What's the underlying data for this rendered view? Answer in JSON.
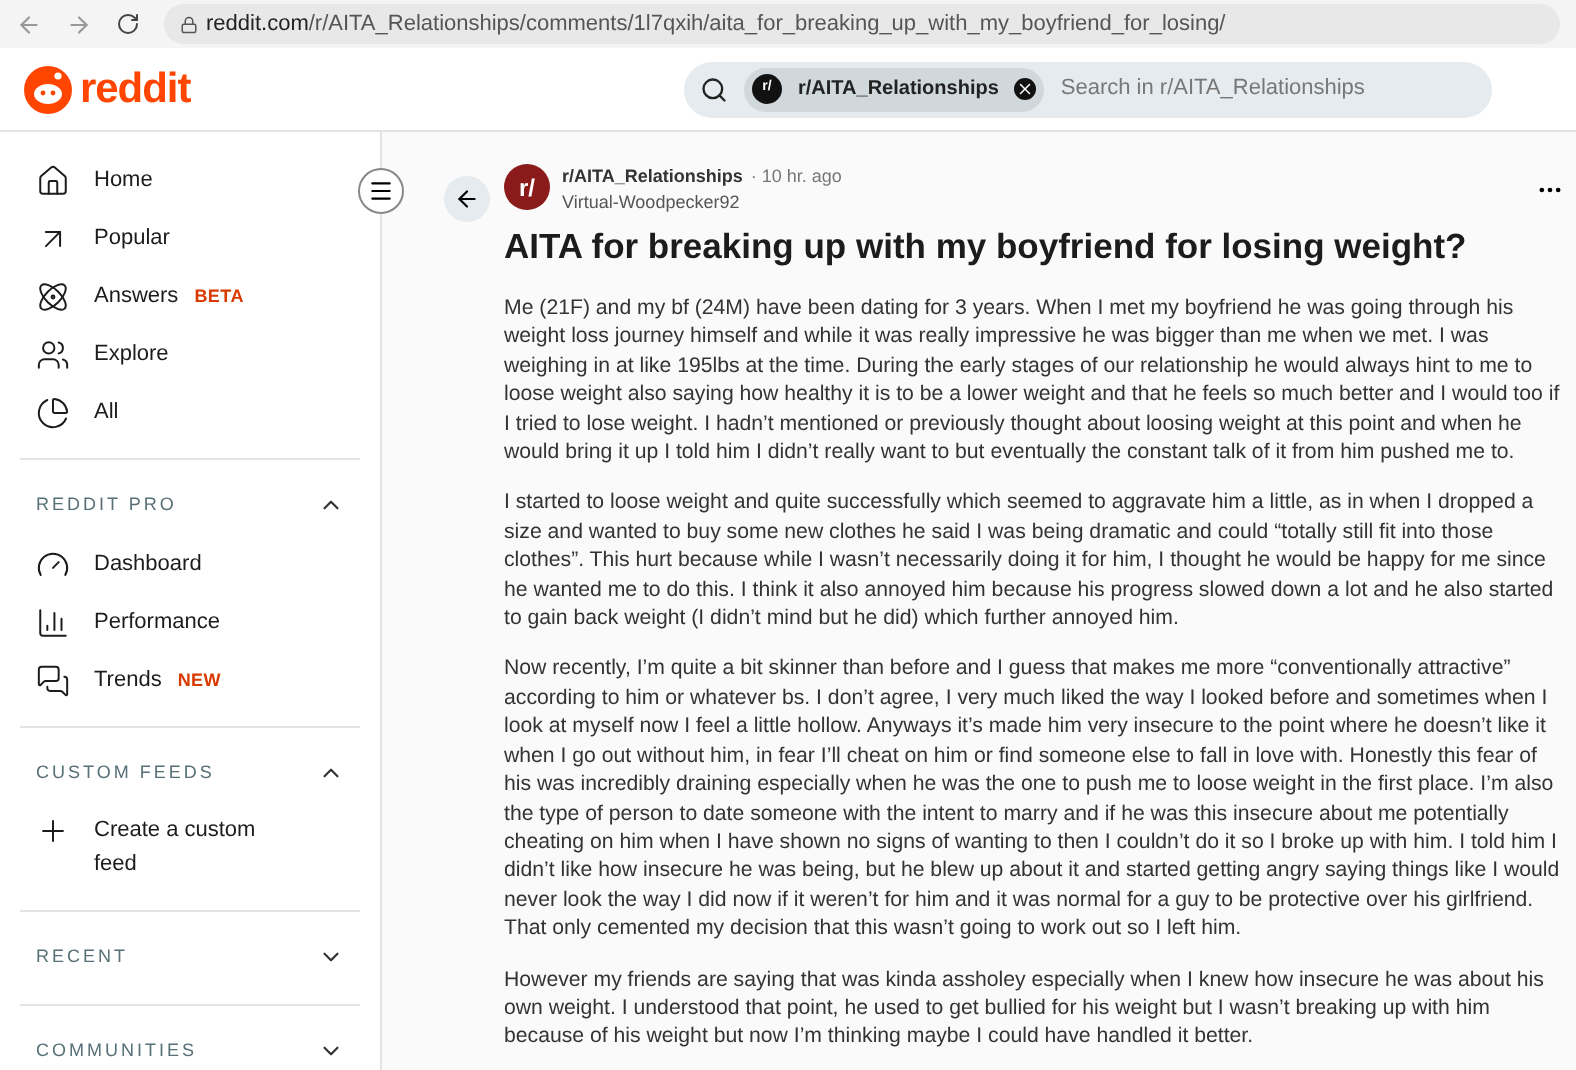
{
  "browser": {
    "url_host": "reddit.com",
    "url_path": "/r/AITA_Relationships/comments/1l7qxih/aita_for_breaking_up_with_my_boyfriend_for_losing/"
  },
  "header": {
    "logo_text": "reddit",
    "search": {
      "chip": "r/AITA_Relationships",
      "chip_icon": "r/",
      "placeholder": "Search in r/AITA_Relationships"
    }
  },
  "sidebar": {
    "items": [
      {
        "label": "Home"
      },
      {
        "label": "Popular"
      },
      {
        "label": "Answers",
        "badge": "BETA"
      },
      {
        "label": "Explore"
      },
      {
        "label": "All"
      }
    ],
    "sections": [
      {
        "title": "REDDIT PRO",
        "expanded": true,
        "items": [
          {
            "label": "Dashboard"
          },
          {
            "label": "Performance"
          },
          {
            "label": "Trends",
            "badge": "NEW"
          }
        ]
      },
      {
        "title": "CUSTOM FEEDS",
        "expanded": true,
        "items": [
          {
            "label": "Create a custom feed"
          }
        ]
      },
      {
        "title": "RECENT",
        "expanded": false
      },
      {
        "title": "COMMUNITIES",
        "expanded": false
      }
    ]
  },
  "post": {
    "avatar": "r/",
    "subreddit": "r/AITA_Relationships",
    "time": "· 10 hr. ago",
    "author": "Virtual-Woodpecker92",
    "title": "AITA for breaking up with my boyfriend for losing weight?",
    "paragraphs": [
      "Me (21F) and my bf (24M) have been dating for 3 years. When I met my boyfriend he was going through his weight loss journey himself and while it was really impressive he was bigger than me when we met. I was weighing in at like 195lbs at the time. During the early stages of our relationship he would always hint to me to loose weight also saying how healthy it is to be a lower weight and that he feels so much better and I would too if I tried to lose weight. I hadn’t mentioned or previously thought about loosing weight at this point and when he would bring it up I told him I didn’t really want to but eventually the constant talk of it from him pushed me to.",
      "I started to loose weight and quite successfully which seemed to aggravate him a little, as in when I dropped a size and wanted to buy some new clothes he said I was being dramatic and could “totally still fit into those clothes”. This hurt because while I wasn’t necessarily doing it for him, I thought he would be happy for me since he wanted me to do this. I think it also annoyed him because his progress slowed down a lot and he also started to gain back weight (I didn’t mind but he did) which further annoyed him.",
      "Now recently, I’m quite a bit skinner than before and I guess that makes me more “conventionally attractive” according to him or whatever bs. I don’t agree, I very much liked the way I looked before and sometimes when I look at myself now I feel a little hollow. Anyways it’s made him very insecure to the point where he doesn’t like it when I go out without him, in fear I’ll cheat on him or find someone else to fall in love with. Honestly this fear of his was incredibly draining especially when he was the one to push me to loose weight in the first place. I’m also the type of person to date someone with the intent to marry and if he was this insecure about me potentially cheating on him when I have shown no signs of wanting to then I couldn’t do it so I broke up with him. I told him I didn’t like how insecure he was being, but he blew up about it and started getting angry saying things like I would never look the way I did now if it weren’t for him and it was normal for a guy to be protective over his girlfriend. That only cemented my decision that this wasn’t going to work out so I left him.",
      "However my friends are saying that was kinda assholey especially when I knew how insecure he was about his own weight. I understood that point, he used to get bullied for his weight but I wasn’t breaking up with him because of his weight but now I’m thinking maybe I could have handled it better."
    ]
  }
}
